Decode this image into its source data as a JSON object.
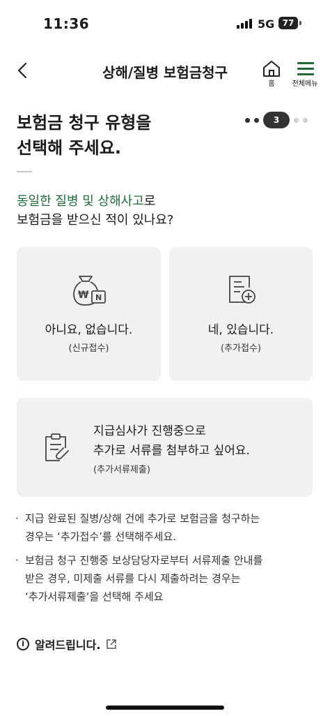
{
  "status_bar": {
    "time": "11:36",
    "network": "5G",
    "battery": "77"
  },
  "header": {
    "title": "상해/질병 보험금청구",
    "home_label": "홈",
    "menu_label": "전체메뉴"
  },
  "heading": {
    "line1": "보험금 청구 유형을",
    "line2": "선택해 주세요."
  },
  "stepper": {
    "current": "3"
  },
  "question": {
    "highlight": "동일한 질병 및 상해사고",
    "suffix": "로",
    "line2": "보험금을 받으신 적이 있나요?"
  },
  "options": {
    "new": {
      "label": "아니요, 없습니다.",
      "sub": "(신규접수)",
      "icon": "money-bag-icon"
    },
    "add": {
      "label": "네, 있습니다.",
      "sub": "(추가접수)",
      "icon": "document-plus-icon"
    },
    "supplement": {
      "line1": "지급심사가 진행중으로",
      "line2": "추가로 서류를 첨부하고 싶어요.",
      "sub": "(추가서류제출)",
      "icon": "clipboard-attach-icon"
    }
  },
  "notes": [
    {
      "line1": "지급 완료된 질병/상해 건에 추가로 보험금을 청구하는",
      "line2": "경우는 ‘추가접수’를 선택해주세요."
    },
    {
      "line1": "보험금 청구 진행중 보상담당자로부터 서류제출 안내를",
      "line2": "받은 경우, 미제출 서류를 다시 제출하려는 경우는",
      "line3": "‘추가서류제출‘을 선택해 주세요"
    }
  ],
  "notice": {
    "label": "알려드립니다."
  },
  "colors": {
    "accent_green": "#1f6b3a",
    "card_bg": "#f1f1f1"
  }
}
